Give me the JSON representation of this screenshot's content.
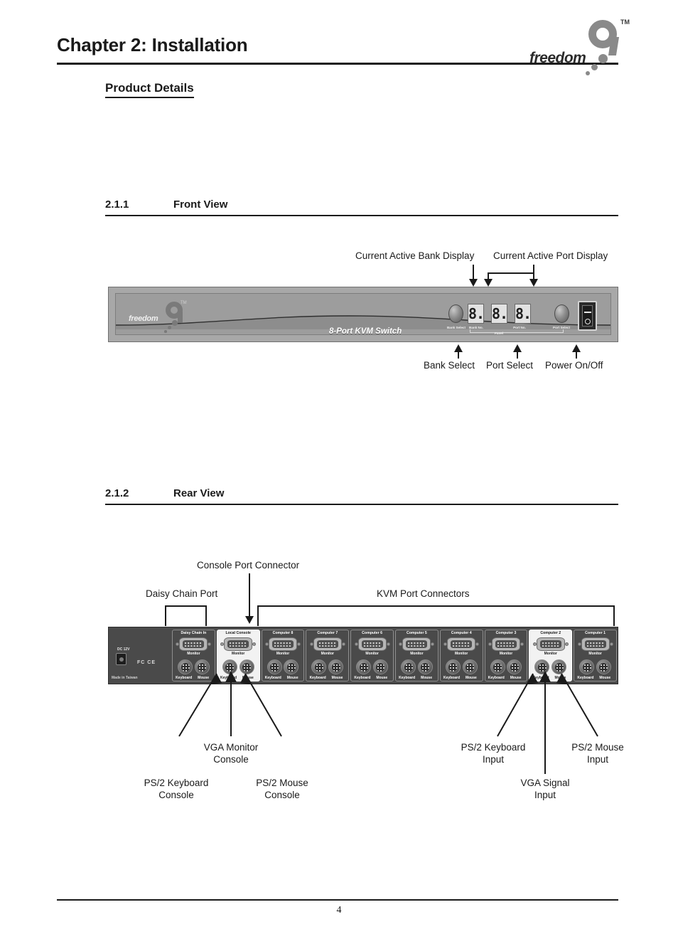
{
  "header": {
    "chapter_title": "Chapter 2: Installation",
    "logo_word": "freedom",
    "logo_tm": "TM"
  },
  "product_details_heading": "Product Details",
  "sections": {
    "front": {
      "number": "2.1.1",
      "title": "Front View"
    },
    "rear": {
      "number": "2.1.2",
      "title": "Rear View"
    }
  },
  "front_view": {
    "callouts_top": {
      "bank_display": "Current Active Bank Display",
      "port_display": "Current Active Port Display"
    },
    "callouts_bottom": {
      "bank_select": "Bank Select",
      "port_select": "Port Select",
      "power": "Power On/Off"
    },
    "panel": {
      "logo_word": "freedom",
      "logo_tm": "TM",
      "model": "8-Port KVM Switch",
      "segments": [
        "8.",
        "8.",
        "8."
      ],
      "micro_labels": {
        "bank_select": "Bank Select",
        "bank_no": "Bank No.",
        "port_no": "Port No.",
        "port_select": "Port Select",
        "panel": "Panel"
      },
      "power_switch": {
        "on_symbol": "—",
        "off_symbol": "○"
      }
    }
  },
  "rear_view": {
    "callouts_top": {
      "console_port": "Console Port Connector",
      "daisy_chain": "Daisy Chain Port",
      "kvm_ports": "KVM Port Connectors"
    },
    "callouts_bottom": {
      "vga_monitor_console": "VGA Monitor\nConsole",
      "vga_monitor_console_l1": "VGA Monitor",
      "vga_monitor_console_l2": "Console",
      "ps2_keyboard_console_l1": "PS/2 Keyboard",
      "ps2_keyboard_console_l2": "Console",
      "ps2_mouse_console_l1": "PS/2 Mouse",
      "ps2_mouse_console_l2": "Console",
      "ps2_keyboard_input_l1": "PS/2 Keyboard",
      "ps2_keyboard_input_l2": "Input",
      "ps2_mouse_input_l1": "PS/2 Mouse",
      "ps2_mouse_input_l2": "Input",
      "vga_signal_input_l1": "VGA Signal",
      "vga_signal_input_l2": "Input"
    },
    "panel": {
      "dc_label": "DC 12V",
      "cert_marks": "FC CE",
      "made_in": "Made in Taiwan",
      "sub_labels": {
        "monitor": "Monitor",
        "keyboard": "Keyboard",
        "mouse": "Mouse"
      },
      "groups": [
        {
          "title": "Daisy Chain In",
          "highlight": false
        },
        {
          "title": "Local Console",
          "highlight": true
        },
        {
          "title": "Computer 8",
          "highlight": false
        },
        {
          "title": "Computer 7",
          "highlight": false
        },
        {
          "title": "Computer 6",
          "highlight": false
        },
        {
          "title": "Computer 5",
          "highlight": false
        },
        {
          "title": "Computer 4",
          "highlight": false
        },
        {
          "title": "Computer 3",
          "highlight": false
        },
        {
          "title": "Computer 2",
          "highlight": true
        },
        {
          "title": "Computer 1",
          "highlight": false
        }
      ]
    }
  },
  "footer": {
    "page_number": "4"
  },
  "colors": {
    "ink": "#1a1a1a",
    "front_panel": "#a8a8a8",
    "rear_panel": "#4a4a4a",
    "logo_gray": "#8a8a8a"
  }
}
